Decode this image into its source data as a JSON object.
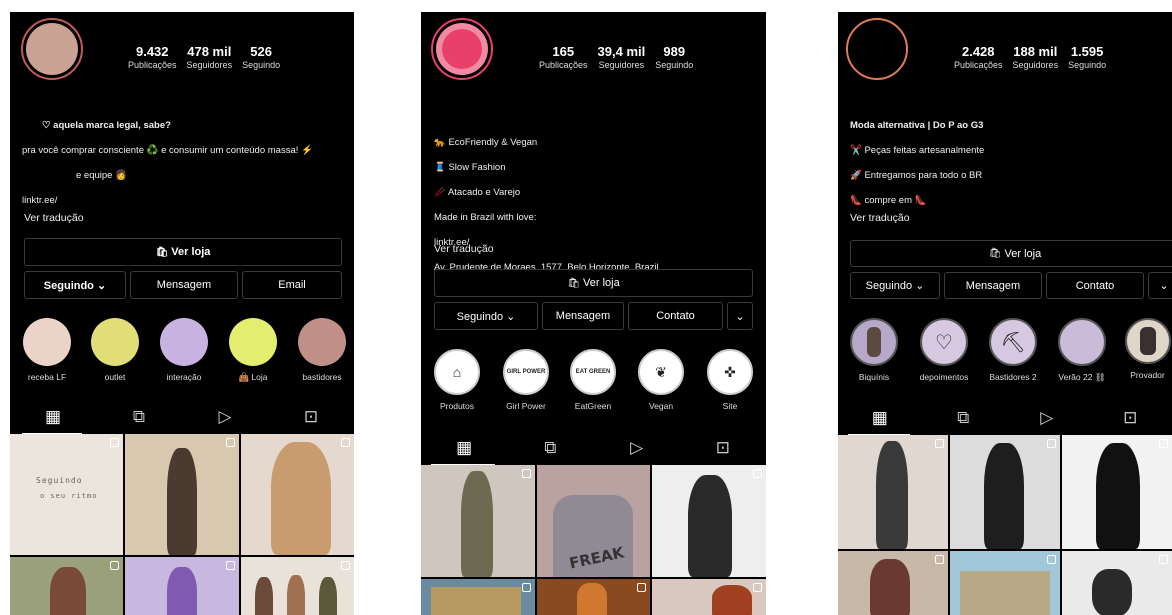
{
  "colors": {
    "bg": "#000000",
    "text": "#ffffff",
    "border": "#3a3a3a"
  },
  "profiles": [
    {
      "avatar_color": "#c9a294",
      "stats": [
        {
          "num": "9.432",
          "label": "Publicações"
        },
        {
          "num": "478 mil",
          "label": "Seguidores"
        },
        {
          "num": "526",
          "label": "Seguindo"
        }
      ],
      "bio": {
        "line1": "♡ aquela marca legal, sabe?",
        "line2": "pra você comprar consciente ♻️ e consumir um conteúdo massa! ⚡",
        "line3": "e equipe 👩",
        "line4": "linktr.ee/"
      },
      "translate": "Ver tradução",
      "shop": "Ver loja",
      "following": "Seguindo ⌄",
      "message": "Mensagem",
      "third": "Email",
      "highlights": [
        {
          "label": "receba LF",
          "color": "#ecd3c8"
        },
        {
          "label": "outlet",
          "color": "#e2de77"
        },
        {
          "label": "interação",
          "color": "#c8b2e2"
        },
        {
          "label": "👜 Loja",
          "color": "#e4ee6e"
        },
        {
          "label": "bastidores",
          "color": "#c09088"
        }
      ],
      "grid_text": {
        "t1": "Seguindo",
        "t2": "o seu ritmo"
      }
    },
    {
      "avatar_color": "#e8406a",
      "stats": [
        {
          "num": "165",
          "label": "Publicações"
        },
        {
          "num": "39,4 mil",
          "label": "Seguidores"
        },
        {
          "num": "989",
          "label": "Seguindo"
        }
      ],
      "bio": {
        "line1": "🐆 EcoFriendly & Vegan",
        "line2": "🧵 Slow Fashion",
        "line3": "🥢 Atacado e Varejo",
        "line4": "Made in Brazil with love:",
        "line5": "linktr.ee/",
        "line6": "Av. Prudente de Moraes, 1577, Belo Horizonte, Brazil"
      },
      "translate": "Ver tradução",
      "shop": "Ver loja",
      "following": "Seguindo ⌄",
      "message": "Mensagem",
      "third": "Contato",
      "more": "⌄",
      "highlights": [
        {
          "label": "Produtos",
          "inner": ""
        },
        {
          "label": "Girl Power",
          "inner": "GIRL POWER"
        },
        {
          "label": "EatGreen",
          "inner": "EAT GREEN"
        },
        {
          "label": "Vegan",
          "inner": ""
        },
        {
          "label": "Site",
          "inner": ""
        }
      ],
      "grid_text": {
        "freak": "FREAK"
      }
    },
    {
      "avatar_color": "#000000",
      "stats": [
        {
          "num": "2.428",
          "label": "Publicações"
        },
        {
          "num": "188 mil",
          "label": "Seguidores"
        },
        {
          "num": "1.595",
          "label": "Seguindo"
        }
      ],
      "bio": {
        "line1": "Moda alternativa | Do P ao G3",
        "line2": "✂️ Peças feitas artesanalmente",
        "line3": "🚀 Entregamos para todo o BR",
        "line4": "👠 compre em 👠"
      },
      "translate": "Ver tradução",
      "shop": "Ver loja",
      "following": "Seguindo ⌄",
      "message": "Mensagem",
      "third": "Contato",
      "more": "⌄",
      "highlights": [
        {
          "label": "Biquínis",
          "icon": ""
        },
        {
          "label": "depoimentos",
          "icon": "♡"
        },
        {
          "label": "Bastidores 2",
          "icon": "⛏"
        },
        {
          "label": "Verão 22 ⛓",
          "icon": ""
        },
        {
          "label": "Provador",
          "icon": ""
        }
      ]
    }
  ],
  "tab_icons": [
    "grid-icon",
    "reels-icon",
    "play-icon",
    "tagged-icon"
  ]
}
